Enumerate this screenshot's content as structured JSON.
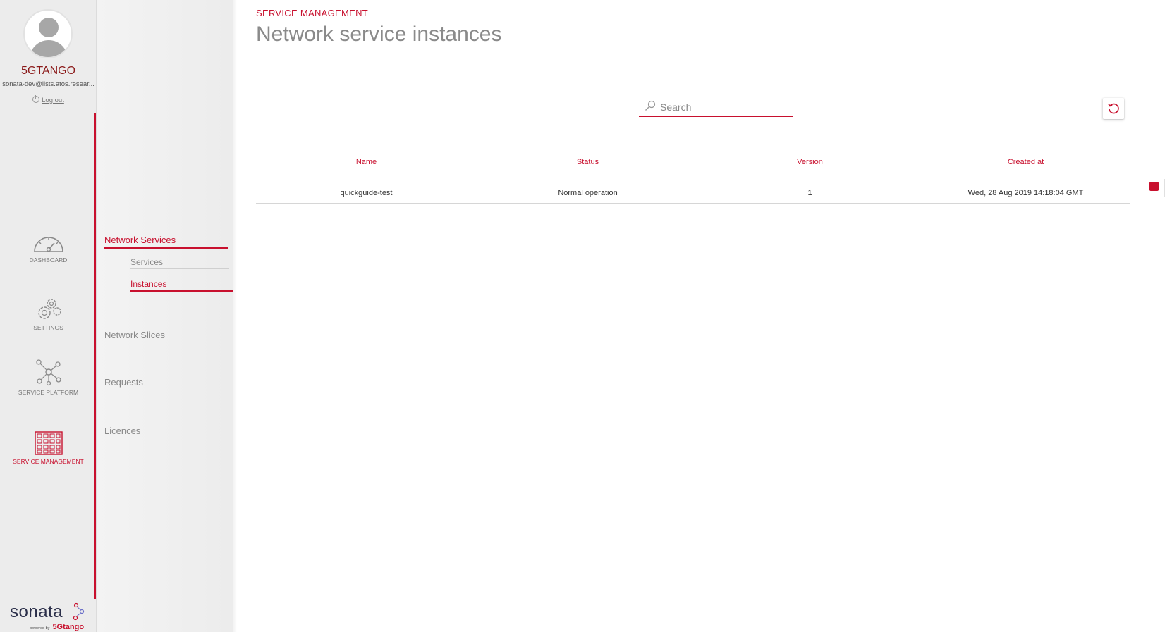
{
  "user": {
    "name": "5GTANGO",
    "email": "sonata-dev@lists.atos.resear...",
    "logout_label": "Log out"
  },
  "nav": {
    "items": [
      {
        "label": "DASHBOARD",
        "icon": "gauge-icon"
      },
      {
        "label": "SETTINGS",
        "icon": "gears-icon"
      },
      {
        "label": "SERVICE PLATFORM",
        "icon": "network-nodes-icon"
      },
      {
        "label": "SERVICE MANAGEMENT",
        "icon": "grid-icon",
        "active": true
      }
    ]
  },
  "brand": {
    "name": "sonata",
    "powered_by": "powered by",
    "tango": "5Gtango"
  },
  "submenu": {
    "network_services": "Network Services",
    "services": "Services",
    "instances": "Instances",
    "network_slices": "Network Slices",
    "requests": "Requests",
    "licences": "Licences"
  },
  "header": {
    "breadcrumb": "SERVICE MANAGEMENT",
    "title": "Network service instances"
  },
  "search": {
    "placeholder": "Search",
    "value": ""
  },
  "table": {
    "columns": [
      "Name",
      "Status",
      "Version",
      "Created at"
    ],
    "rows": [
      {
        "name": "quickguide-test",
        "status": "Normal operation",
        "version": "1",
        "created_at": "Wed, 28 Aug 2019 14:18:04 GMT"
      }
    ]
  },
  "colors": {
    "accent": "#c8102e",
    "rail_bg": "#ececec",
    "title_gray": "#8a8a8a"
  }
}
